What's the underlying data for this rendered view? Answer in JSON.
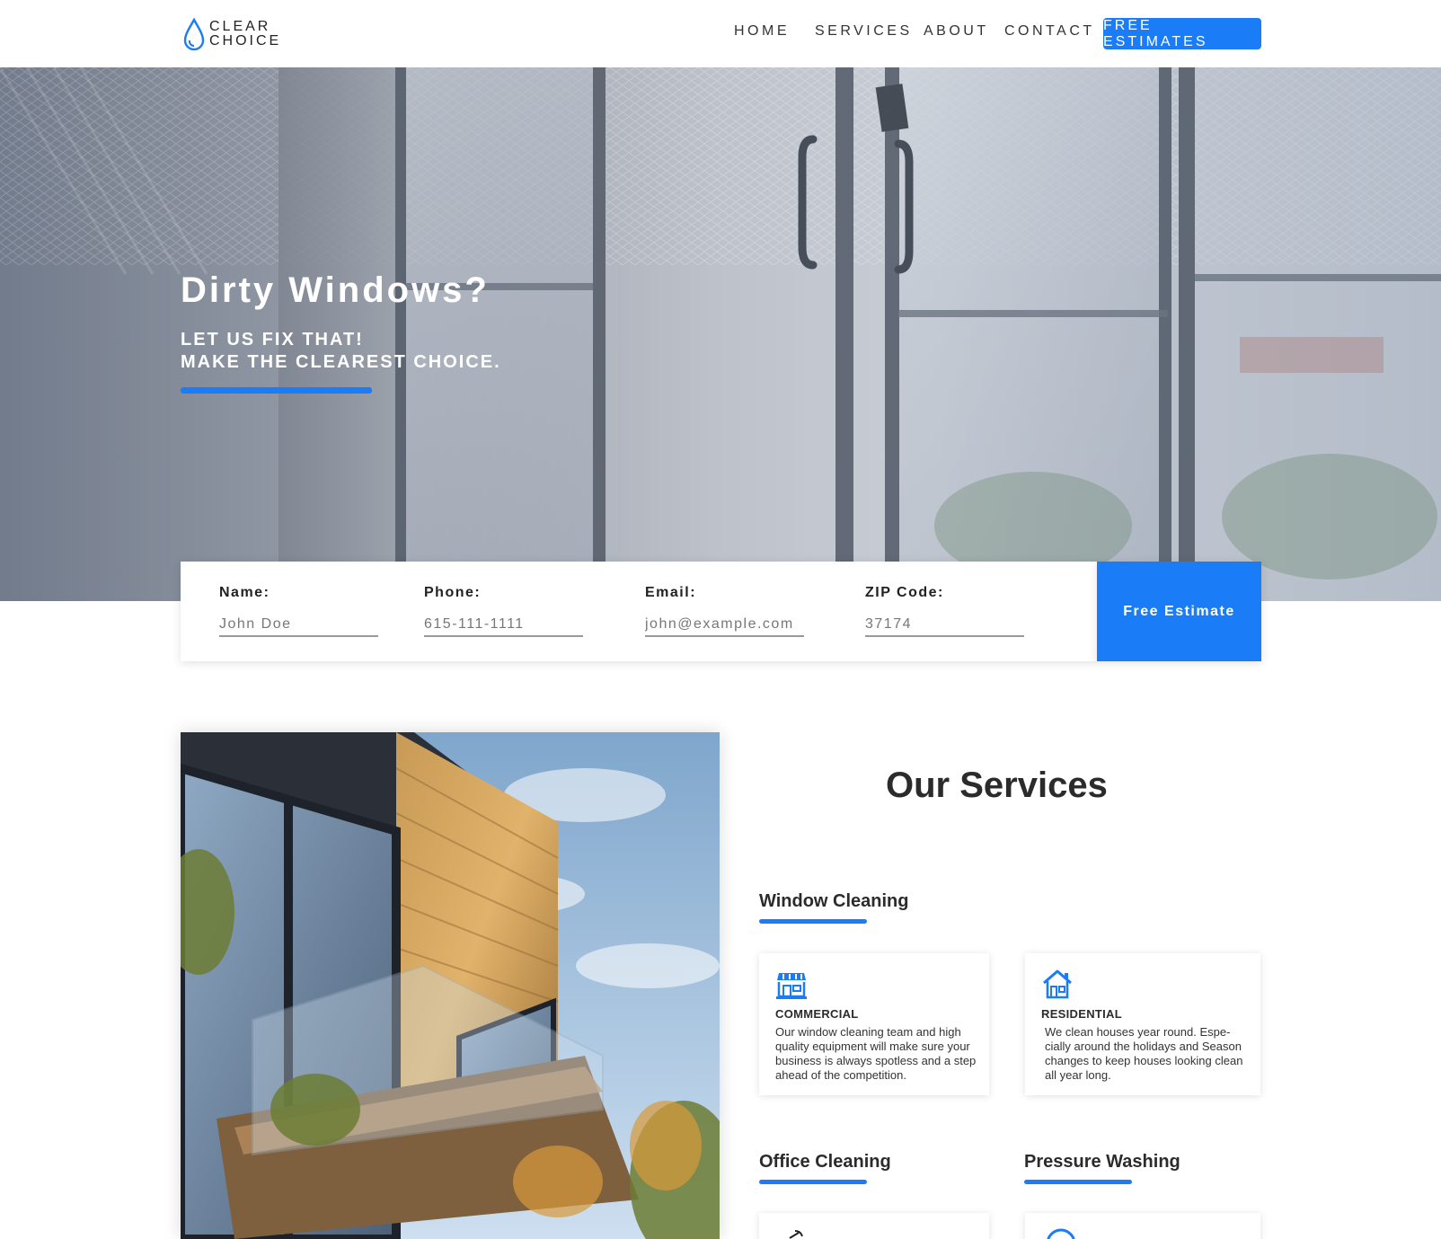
{
  "header": {
    "logo": {
      "line1": "CLEAR",
      "line2": "CHOICE",
      "icon": "water-drop-icon"
    },
    "nav": [
      {
        "label": "HOME"
      },
      {
        "label": "SERVICES"
      },
      {
        "label": "ABOUT"
      },
      {
        "label": "CONTACT"
      }
    ],
    "cta_label": "FREE ESTIMATES"
  },
  "hero": {
    "title": "Dirty Windows?",
    "subtitle_line1": "LET US FIX THAT!",
    "subtitle_line2": "MAKE THE CLEAREST CHOICE."
  },
  "estimate_form": {
    "fields": [
      {
        "label": "Name:",
        "placeholder": "John Doe"
      },
      {
        "label": "Phone:",
        "placeholder": "615-111-1111"
      },
      {
        "label": "Email:",
        "placeholder": "john@example.com"
      },
      {
        "label": "ZIP Code:",
        "placeholder": "37174"
      }
    ],
    "submit_label": "Free Estimate"
  },
  "services": {
    "title": "Our Services",
    "window_cleaning": {
      "heading": "Window Cleaning",
      "cards": [
        {
          "icon": "storefront-icon",
          "title": "COMMERCIAL",
          "description": "Our window cleaning team and high quality equipment will make sure your business is always spotless and a step ahead of the competition."
        },
        {
          "icon": "house-icon",
          "title": "RESIDENTIAL",
          "description": "We clean houses year round. Espe-cially around the holidays and Season changes to keep houses looking clean all year long."
        }
      ]
    },
    "office_cleaning": {
      "heading": "Office Cleaning",
      "icon": "spray-bottle-icon"
    },
    "pressure_washing": {
      "heading": "Pressure Washing",
      "icon": "globe-icon"
    }
  },
  "colors": {
    "accent": "#1a7cf6",
    "text_dark": "#2b2b2b",
    "white": "#ffffff"
  }
}
